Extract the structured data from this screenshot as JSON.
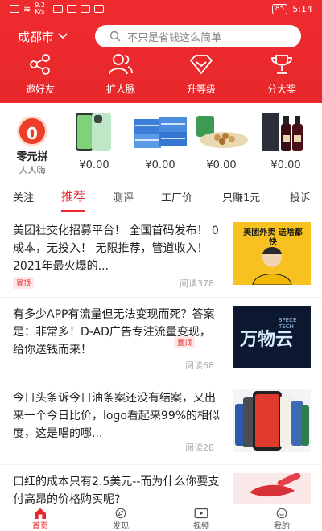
{
  "statusbar": {
    "net_speed": "9.2 K/s",
    "battery": "85",
    "time": "5:14"
  },
  "header": {
    "city": "成都市",
    "search_placeholder": "不只是省钱这么简单"
  },
  "actions": [
    {
      "label": "邀好友",
      "icon": "share-icon"
    },
    {
      "label": "扩人脉",
      "icon": "people-icon"
    },
    {
      "label": "升等级",
      "icon": "diamond-icon"
    },
    {
      "label": "分大奖",
      "icon": "trophy-icon"
    }
  ],
  "zero_buy": {
    "badge": "0",
    "title": "零元拼",
    "subtitle": "人人嗨"
  },
  "products": [
    {
      "price": "¥0.00",
      "icon": "phone-image"
    },
    {
      "price": "¥0.00",
      "icon": "tissue-image"
    },
    {
      "price": "¥0.00",
      "icon": "snack-image"
    },
    {
      "price": "¥0.00",
      "icon": "wine-image"
    }
  ],
  "tabs": [
    "关注",
    "推荐",
    "测评",
    "工厂价",
    "只赚1元",
    "投诉"
  ],
  "active_tab": "推荐",
  "news": [
    {
      "title": "美团社交化招募平台！ 全国首码发布！ 0成本，无投入！ 无限推荐，管道收入！ 2021年最火爆的...",
      "tag": "置顶",
      "reads": "阅读378",
      "thumb_text": "美团外卖 送啥都快"
    },
    {
      "title": "有多少APP有流量但无法变现而死？答案是：非常多！D-AD广告专注流量变现，给你送钱而来！",
      "tag": "置顶",
      "reads": "阅读68",
      "thumb_text": "万物云"
    },
    {
      "title": "今日头条诉今日油条案还没有结案，又出来一个今日比价，logo看起来99%的相似度，这是唱的哪...",
      "tag": "",
      "reads": "阅读28",
      "thumb_text": ""
    },
    {
      "title": "口红的成本只有2.5美元--而为什么你要支付高昂的价格购买呢?",
      "tag": "",
      "reads": "",
      "thumb_text": ""
    }
  ],
  "bottom_nav": [
    {
      "label": "首页",
      "icon": "home-icon"
    },
    {
      "label": "发现",
      "icon": "compass-icon"
    },
    {
      "label": "视频",
      "icon": "video-icon"
    },
    {
      "label": "我的",
      "icon": "profile-icon"
    }
  ],
  "colors": {
    "brand": "#e8282c",
    "price": "#333333"
  }
}
